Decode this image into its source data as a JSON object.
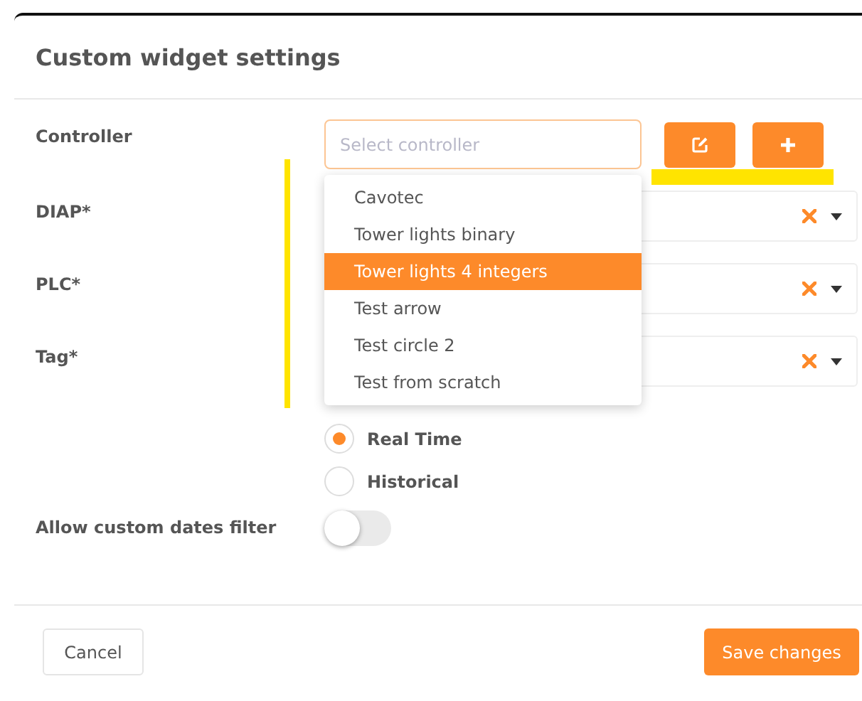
{
  "dialog": {
    "title": "Custom widget settings"
  },
  "controller": {
    "label": "Controller",
    "placeholder": "Select controller",
    "options": [
      {
        "label": "Cavotec",
        "selected": false
      },
      {
        "label": "Tower lights binary",
        "selected": false
      },
      {
        "label": "Tower lights 4 integers",
        "selected": true
      },
      {
        "label": "Test arrow",
        "selected": false
      },
      {
        "label": "Test circle 2",
        "selected": false
      },
      {
        "label": "Test from scratch",
        "selected": false
      }
    ]
  },
  "selects": [
    {
      "label": "DIAP*"
    },
    {
      "label": "PLC*"
    },
    {
      "label": "Tag*"
    }
  ],
  "mode": [
    {
      "label": "Real Time",
      "selected": true
    },
    {
      "label": "Historical",
      "selected": false
    }
  ],
  "custom_dates": {
    "label": "Allow custom dates filter",
    "on": false
  },
  "footer": {
    "cancel": "Cancel",
    "save": "Save changes"
  }
}
